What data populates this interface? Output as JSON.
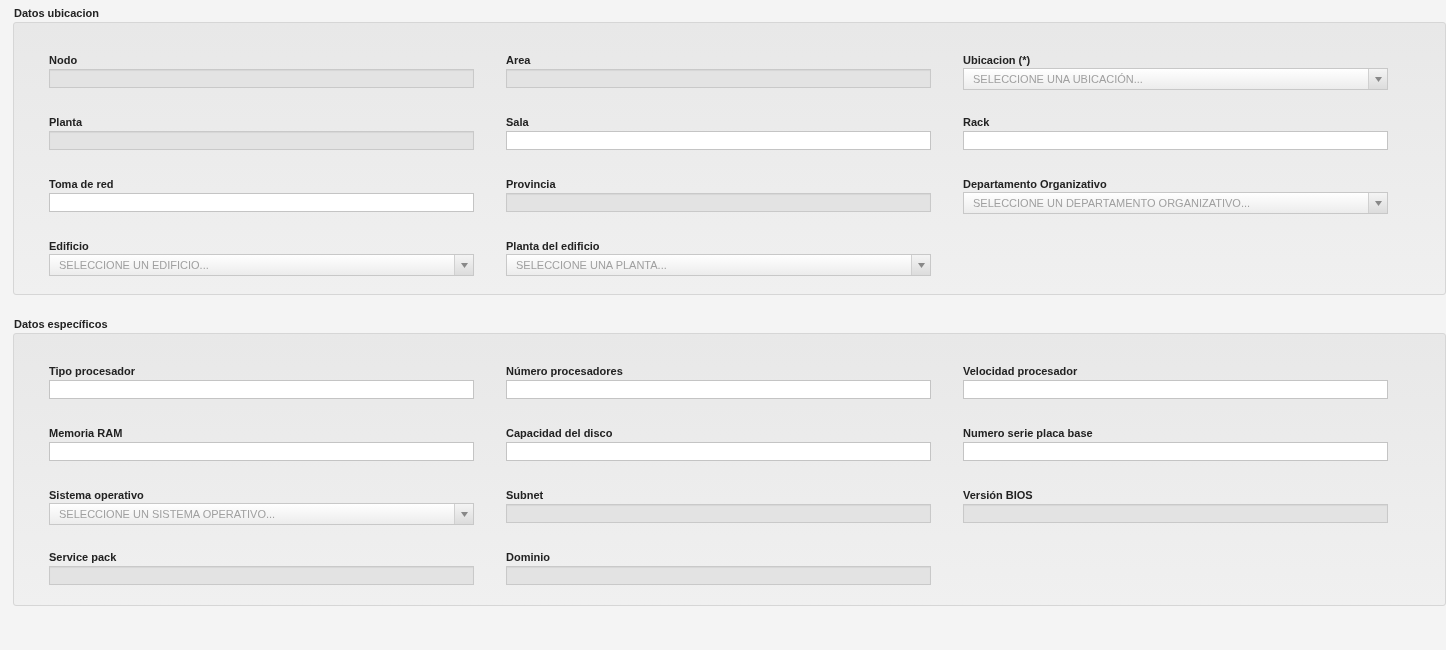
{
  "sections": [
    {
      "title": "Datos ubicacion",
      "fields": [
        {
          "label": "Nodo",
          "kind": "text",
          "disabled": true
        },
        {
          "label": "Area",
          "kind": "text",
          "disabled": true
        },
        {
          "label": "Ubicacion (*)",
          "kind": "select",
          "placeholder": "SELECCIONE UNA UBICACIÓN..."
        },
        {
          "label": "Planta",
          "kind": "text",
          "disabled": true
        },
        {
          "label": "Sala",
          "kind": "text",
          "disabled": false
        },
        {
          "label": "Rack",
          "kind": "text",
          "disabled": false
        },
        {
          "label": "Toma de red",
          "kind": "text",
          "disabled": false
        },
        {
          "label": "Provincia",
          "kind": "text",
          "disabled": true
        },
        {
          "label": "Departamento Organizativo",
          "kind": "select",
          "placeholder": "SELECCIONE UN DEPARTAMENTO ORGANIZATIVO..."
        },
        {
          "label": "Edificio",
          "kind": "select",
          "placeholder": "SELECCIONE UN EDIFICIO..."
        },
        {
          "label": "Planta del edificio",
          "kind": "select",
          "placeholder": "SELECCIONE UNA PLANTA..."
        }
      ]
    },
    {
      "title": "Datos específicos",
      "fields": [
        {
          "label": "Tipo procesador",
          "kind": "text",
          "disabled": false
        },
        {
          "label": "Número procesadores",
          "kind": "text",
          "disabled": false
        },
        {
          "label": "Velocidad procesador",
          "kind": "text",
          "disabled": false
        },
        {
          "label": "Memoria RAM",
          "kind": "text",
          "disabled": false
        },
        {
          "label": "Capacidad del disco",
          "kind": "text",
          "disabled": false
        },
        {
          "label": "Numero serie placa base",
          "kind": "text",
          "disabled": false
        },
        {
          "label": "Sistema operativo",
          "kind": "select",
          "placeholder": "SELECCIONE UN SISTEMA OPERATIVO..."
        },
        {
          "label": "Subnet",
          "kind": "text",
          "disabled": true
        },
        {
          "label": "Versión BIOS",
          "kind": "text",
          "disabled": true
        },
        {
          "label": "Service pack",
          "kind": "text",
          "disabled": true
        },
        {
          "label": "Dominio",
          "kind": "text",
          "disabled": true
        }
      ]
    }
  ]
}
